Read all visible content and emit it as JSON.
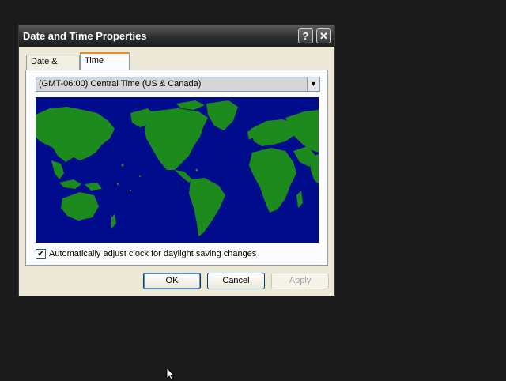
{
  "window": {
    "title": "Date and Time Properties",
    "help_icon": "question-mark",
    "close_icon": "x"
  },
  "tabs": [
    {
      "label": "Date & Time",
      "active": false
    },
    {
      "label": "Time Zone",
      "active": true
    }
  ],
  "timezone": {
    "selected": "(GMT-06:00) Central Time (US & Canada)"
  },
  "map": {
    "ocean_color": "#000c8c",
    "land_color": "#1c8a1c"
  },
  "dst": {
    "label": "Automatically adjust clock for daylight saving changes",
    "checked": true
  },
  "buttons": {
    "ok": "OK",
    "cancel": "Cancel",
    "apply": "Apply"
  }
}
